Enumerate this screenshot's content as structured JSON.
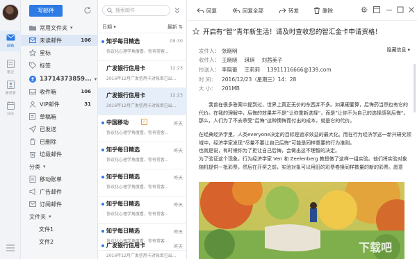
{
  "rail": {
    "items": [
      {
        "label": "邮箱",
        "icon": "mail-icon"
      },
      {
        "label": "笔记",
        "icon": "notes-icon"
      },
      {
        "label": "通讯录",
        "icon": "contacts-icon"
      },
      {
        "label": "日历",
        "icon": "calendar-icon"
      }
    ],
    "menu_icon": "hamburger-menu-icon"
  },
  "folders": {
    "compose_label": "写邮件",
    "account1_name": "常用文件夹",
    "common": [
      {
        "label": "未读邮件",
        "count": "106"
      },
      {
        "label": "星标",
        "count": ""
      },
      {
        "label": "标签",
        "count": ""
      }
    ],
    "account2_name": "13714373859...",
    "account2_folders": [
      {
        "label": "收件箱",
        "count": "106"
      },
      {
        "label": "VIP邮件",
        "count": "31"
      },
      {
        "label": "草稿箱",
        "count": ""
      },
      {
        "label": "已发送",
        "count": ""
      },
      {
        "label": "已删除",
        "count": ""
      },
      {
        "label": "垃圾邮件",
        "count": ""
      }
    ],
    "category_group": "分类",
    "categories": [
      "移动账单",
      "广告邮件",
      "订阅邮件"
    ],
    "file_group": "文件夹",
    "files": [
      "文件1",
      "文件2"
    ]
  },
  "list": {
    "search_placeholder": "搜索邮件",
    "sort_left": "日期",
    "sort_right": "最新",
    "mails": [
      {
        "from": "知乎每日精选",
        "time": "09:30",
        "snippet": "协议化心理学角度看，你有常客..."
      },
      {
        "from": "广发银行信用卡",
        "time": "12:23",
        "snippet": "2016年12月广发信用卡对账单已出..."
      },
      {
        "from": "广发银行信用卡",
        "time": "12:23",
        "snippet": "2016年12月广发信用卡对账单已出..."
      },
      {
        "from": "中国移动",
        "time": "昨天",
        "snippet": "协议化心理学角度看，你有常客..."
      },
      {
        "from": "知乎每日精选",
        "time": "昨天",
        "snippet": "协议化心理学角度看，你有常客..."
      },
      {
        "from": "知乎每日精选",
        "time": "昨天",
        "snippet": "协议化心理学角度看，你有常客..."
      },
      {
        "from": "知乎每日精选",
        "time": "昨天",
        "snippet": "协议化心理学角度看，你有常客..."
      },
      {
        "from": "知乎每日精选",
        "time": "昨天",
        "snippet": "协议化心理学角度看，你有常客..."
      },
      {
        "from": "广发银行信用卡",
        "time": "昨天",
        "snippet": "2016年12月广发信用卡对账单已出..."
      }
    ]
  },
  "reader": {
    "toolbar": {
      "reply": "回复",
      "reply_all": "回复全部",
      "forward": "转发",
      "delete": "删除"
    },
    "subject": "开启有“智”青年新生活！请及时查收您的智汇金卡申请资格！",
    "hide_detail": "隐藏信息",
    "meta": {
      "from_key": "发件人：",
      "from": "张晓明",
      "to_key": "收件人：",
      "to": [
        "王晓晓",
        "琪琪",
        "刘茜美子"
      ],
      "cc_key": "抄送人：",
      "cc": [
        "李晓蕾",
        "王莉莉",
        "13911116666@139.com"
      ],
      "time_key": "时    间：",
      "time": "2016/12/23（星期三）14：28",
      "size_key": "大    小：",
      "size": "201MB"
    },
    "body": [
      "我曾在很多答案中提到过，世界上真正无价的东西并不多。如果硬要算，后悔药当然也有它的代价。在我的理解中，后悔的效果并不是”让你重新选择“，而是”让你不为自己的选择感到后悔“。那么，人们为了不去承受”后悔“这种懊悔而付出的成本，就是它的代价。",
      "在经典经济学里，人类everyone决定的目标是追求效益的最大化。而在行为经济学这一新兴研究领域中，经济学家发现”尽量不要让自己后悔“可能是同样重要的行为准则。",
      "也就是说，有时候你为了拒让自己后悔，会做出这不理智的决定。",
      "为了验证这个现象，行为经济学家 Ven 和 Zeelenberg 教授做了这样一组实验。他们将实验对象随机提供一批彩票，然后在开奖之前，实验对象可以用旧的彩票卷换同样数量的新的彩票。愿意"
    ],
    "watermark": "下载吧"
  }
}
